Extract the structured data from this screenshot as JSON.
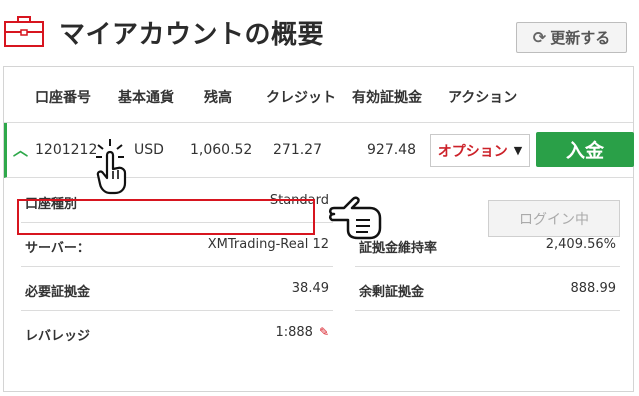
{
  "header": {
    "title": "マイアカウントの概要",
    "refresh_label": "更新する",
    "refresh_icon": "refresh-icon",
    "briefcase_icon": "briefcase-icon"
  },
  "table": {
    "headers": [
      "口座番号",
      "基本通貨",
      "残高",
      "クレジット",
      "有効証拠金",
      "アクション"
    ],
    "row": {
      "account_number": "1201212",
      "currency": "USD",
      "balance": "1,060.52",
      "credit": "271.27",
      "equity": "927.48",
      "option_label": "オプション",
      "deposit_label": "入金"
    }
  },
  "details": {
    "account_type_label": "口座種別",
    "account_type_value": "Standard",
    "server_label": "サーバー：",
    "server_value": "XMTrading-Real 12",
    "margin_label": "必要証拠金",
    "margin_value": "38.49",
    "leverage_label": "レバレッジ",
    "leverage_value": "1:888",
    "margin_level_label": "証拠金維持率",
    "margin_level_value": "2,409.56%",
    "free_margin_label": "余剰証拠金",
    "free_margin_value": "888.99",
    "login_label": "ログイン中"
  },
  "colors": {
    "accent_green": "#2aa048",
    "accent_red": "#cc2129",
    "highlight_red": "#d7151f"
  }
}
